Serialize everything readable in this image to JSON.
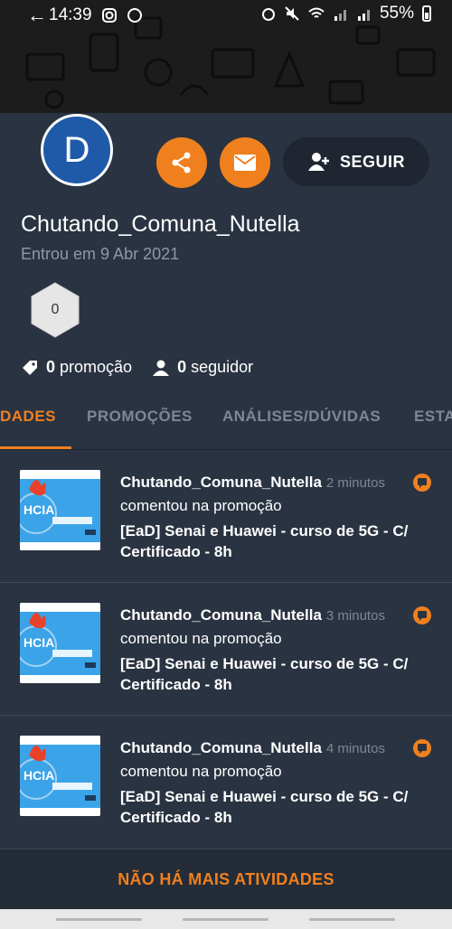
{
  "status_bar": {
    "time": "14:39",
    "battery": "55%"
  },
  "profile": {
    "avatar_letter": "D",
    "follow_label": "SEGUIR",
    "username": "Chutando_Comuna_Nutella",
    "joined": "Entrou em 9 Abr 2021",
    "badge_value": "0",
    "promo_count": "0",
    "promo_label": "promoção",
    "follower_count": "0",
    "follower_label": "seguidor"
  },
  "tabs": [
    {
      "label": "DADES",
      "active": true
    },
    {
      "label": "PROMOÇÕES",
      "active": false
    },
    {
      "label": "ANÁLISES/DÚVIDAS",
      "active": false
    },
    {
      "label": "ESTA",
      "active": false
    }
  ],
  "activities": [
    {
      "user": "Chutando_Comuna_Nutella",
      "time": "2 minutos",
      "action": "comentou na promoção",
      "promo": "[EaD] Senai e Huawei - curso de 5G - C/ Certificado - 8h",
      "thumb_text": "HCIA"
    },
    {
      "user": "Chutando_Comuna_Nutella",
      "time": "3 minutos",
      "action": "comentou na promoção",
      "promo": "[EaD] Senai e Huawei - curso de 5G - C/ Certificado - 8h",
      "thumb_text": "HCIA"
    },
    {
      "user": "Chutando_Comuna_Nutella",
      "time": "4 minutos",
      "action": "comentou na promoção",
      "promo": "[EaD] Senai e Huawei - curso de 5G - C/ Certificado - 8h",
      "thumb_text": "HCIA"
    }
  ],
  "footer": {
    "label": "NÃO HÁ MAIS ATIVIDADES"
  },
  "colors": {
    "accent": "#f0801e",
    "background": "#2a3341",
    "avatar": "#1e5aa8"
  }
}
